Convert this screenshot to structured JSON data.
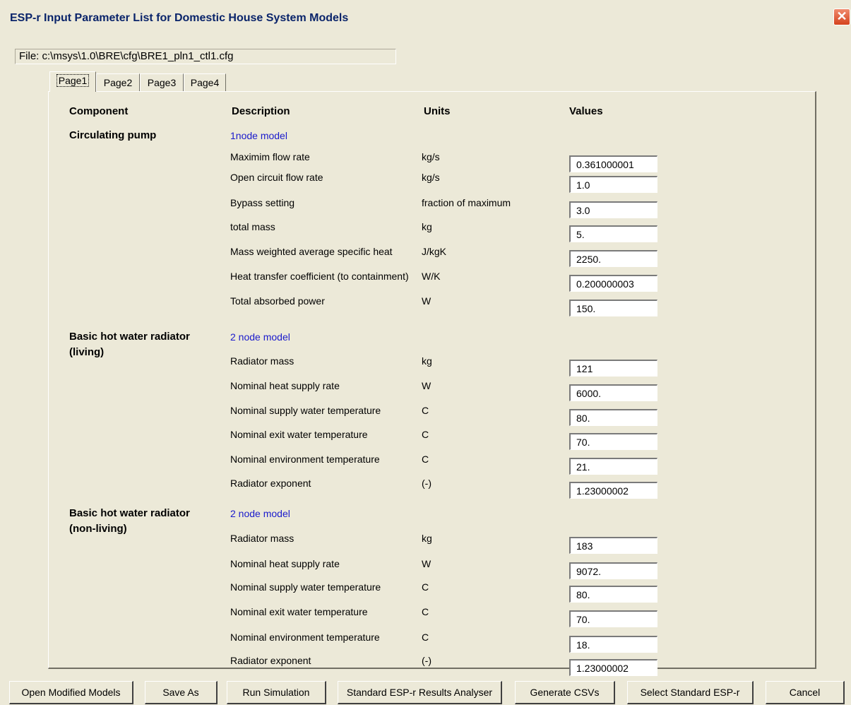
{
  "window": {
    "title": "ESP-r Input Parameter List for Domestic House System Models",
    "close_label": "✕"
  },
  "file": {
    "label": "File:",
    "path": "c:\\msys\\1.0\\BRE\\cfg\\BRE1_pln1_ctl1.cfg"
  },
  "tabs": [
    "Page1",
    "Page2",
    "Page3",
    "Page4"
  ],
  "active_tab": "Page1",
  "headers": {
    "component": "Component",
    "description": "Description",
    "units": "Units",
    "values": "Values"
  },
  "sections": [
    {
      "component_lines": [
        "Circulating  pump"
      ],
      "model": "1node model",
      "params": [
        {
          "description": "Maximim flow rate",
          "unit": "kg/s",
          "value": "0.361000001"
        },
        {
          "description": "Open circuit flow rate",
          "unit": "kg/s",
          "value": "1.0"
        },
        {
          "description": "Bypass setting",
          "unit": "fraction of maximum",
          "value": "3.0"
        },
        {
          "description": "total mass",
          "unit": "kg",
          "value": "5."
        },
        {
          "description": "Mass weighted average specific heat",
          "unit": "J/kgK",
          "value": "2250."
        },
        {
          "description": "Heat transfer coefficient (to containment)",
          "unit": "W/K",
          "value": "0.200000003"
        },
        {
          "description": "Total absorbed power",
          "unit": "W",
          "value": "150."
        }
      ]
    },
    {
      "component_lines": [
        "Basic hot water radiator",
        "(living)"
      ],
      "model": "2 node model",
      "params": [
        {
          "description": "Radiator mass",
          "unit": "kg",
          "value": "121"
        },
        {
          "description": "Nominal heat supply rate",
          "unit": "W",
          "value": "6000."
        },
        {
          "description": "Nominal supply water temperature",
          "unit": "C",
          "value": "80."
        },
        {
          "description": "Nominal exit water temperature",
          "unit": "C",
          "value": "70."
        },
        {
          "description": "Nominal environment temperature",
          "unit": "C",
          "value": "21."
        },
        {
          "description": "Radiator exponent",
          "unit": "(-)",
          "value": "1.23000002"
        }
      ]
    },
    {
      "component_lines": [
        "Basic hot water radiator",
        "(non-living)"
      ],
      "model": "2 node model",
      "params": [
        {
          "description": "Radiator mass",
          "unit": "kg",
          "value": "183"
        },
        {
          "description": "Nominal heat supply rate",
          "unit": "W",
          "value": "9072."
        },
        {
          "description": "Nominal supply water temperature",
          "unit": "C",
          "value": "80."
        },
        {
          "description": "Nominal exit water temperature",
          "unit": "C",
          "value": "70."
        },
        {
          "description": "Nominal environment temperature",
          "unit": "C",
          "value": "18."
        },
        {
          "description": "Radiator exponent",
          "unit": "(-)",
          "value": "1.23000002"
        }
      ]
    }
  ],
  "buttons": {
    "open_modified": "Open Modified Models",
    "save_as": "Save As",
    "run_simulation": "Run Simulation",
    "results_analyser": "Standard ESP-r Results Analyser",
    "generate_csvs": "Generate CSVs",
    "select_standard": "Select Standard ESP-r",
    "cancel": "Cancel"
  }
}
